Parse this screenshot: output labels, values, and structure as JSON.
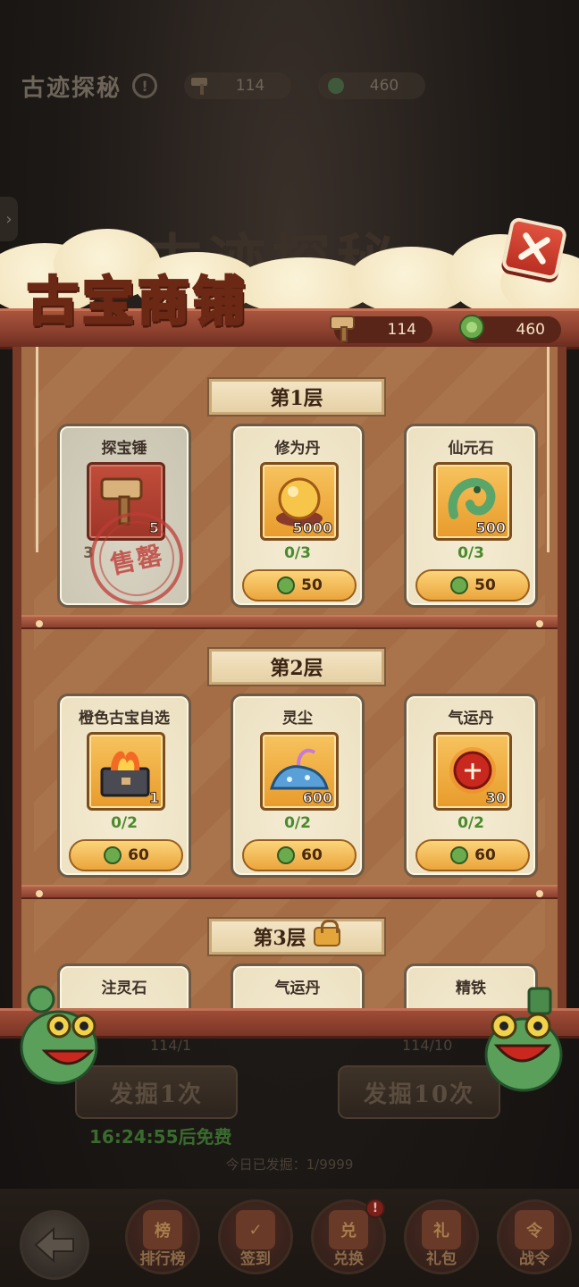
{
  "background": {
    "title": "古迹探秘",
    "resources": [
      {
        "icon": "hammer-icon",
        "value": "114"
      },
      {
        "icon": "jade-icon",
        "value": "460"
      }
    ],
    "big_title": "古迹探秘",
    "dig_once": {
      "counter": "114/1",
      "label": "发掘1次"
    },
    "dig_ten": {
      "counter": "114/10",
      "label": "发掘10次"
    },
    "free_timer": "16:24:55后免费",
    "today_count": "今日已发掘：1/9999",
    "nav": [
      {
        "id": "ranking",
        "label": "排行榜",
        "glyph": "榜",
        "badge": ""
      },
      {
        "id": "signin",
        "label": "签到",
        "glyph": "✓",
        "badge": ""
      },
      {
        "id": "exchange",
        "label": "兑换",
        "glyph": "兑",
        "badge": "!"
      },
      {
        "id": "gift",
        "label": "礼包",
        "glyph": "礼",
        "badge": ""
      },
      {
        "id": "battlepass",
        "label": "战令",
        "glyph": "令",
        "badge": ""
      }
    ]
  },
  "shop": {
    "title": "古宝商铺",
    "resources": [
      {
        "icon": "hammer-icon",
        "value": "114"
      },
      {
        "icon": "jade-icon",
        "value": "460"
      }
    ],
    "tiers": [
      {
        "label": "第1层",
        "locked": false,
        "items": [
          {
            "name": "探宝锤",
            "icon": "hammer-icon",
            "count": "5",
            "limit": "3",
            "price": "",
            "sold": true,
            "stamp": "售罄"
          },
          {
            "name": "修为丹",
            "icon": "golden-pill-icon",
            "count": "5000",
            "limit": "0/3",
            "price": "50",
            "sold": false
          },
          {
            "name": "仙元石",
            "icon": "jade-dragon-icon",
            "count": "500",
            "limit": "0/3",
            "price": "50",
            "sold": false
          }
        ]
      },
      {
        "label": "第2层",
        "locked": false,
        "items": [
          {
            "name": "橙色古宝自选",
            "icon": "treasure-chest-icon",
            "count": "1",
            "limit": "0/2",
            "price": "60",
            "sold": false
          },
          {
            "name": "灵尘",
            "icon": "spirit-dust-icon",
            "count": "600",
            "limit": "0/2",
            "price": "60",
            "sold": false
          },
          {
            "name": "气运丹",
            "icon": "fortune-pill-icon",
            "count": "30",
            "limit": "0/2",
            "price": "60",
            "sold": false
          }
        ]
      },
      {
        "label": "第3层",
        "locked": true,
        "items": [
          {
            "name": "注灵石"
          },
          {
            "name": "气运丹"
          },
          {
            "name": "精铁"
          }
        ]
      }
    ]
  },
  "colors": {
    "accent": "#eba53b",
    "beam": "#8a3f2d",
    "limit_green": "#4b8a2e",
    "stamp_red": "#be3c37"
  }
}
